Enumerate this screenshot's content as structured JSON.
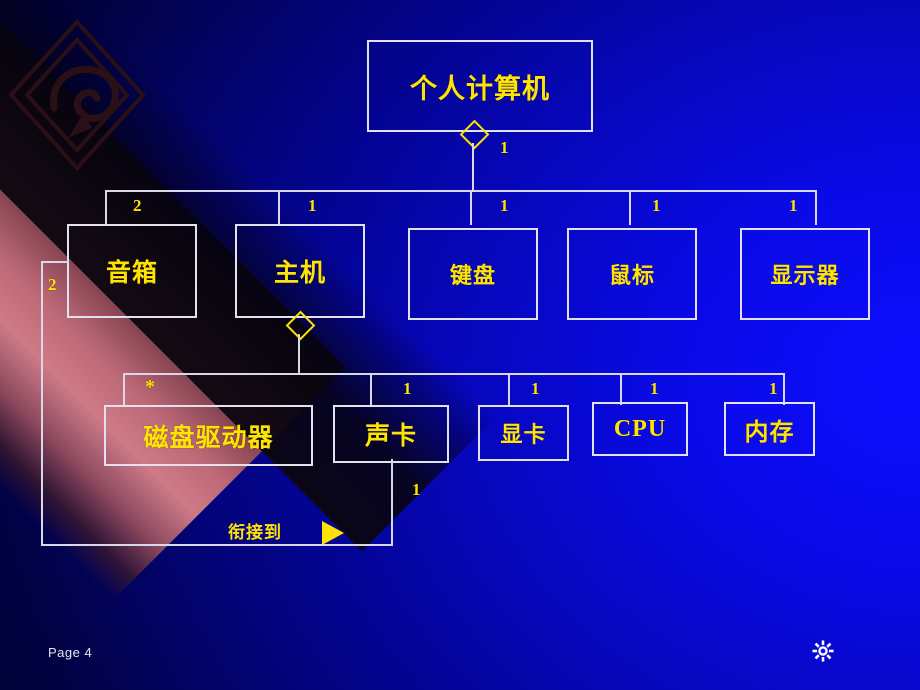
{
  "slide": {
    "page_label": "Page  4",
    "gear_icon": "gear-icon",
    "logo_icon": "diamond-swirl-logo"
  },
  "diagram": {
    "type": "uml-aggregation-hierarchy",
    "root": {
      "label": "个人计算机",
      "multiplicity": "1"
    },
    "level2": [
      {
        "label": "音箱",
        "multiplicity": "2"
      },
      {
        "label": "主机",
        "multiplicity": "1"
      },
      {
        "label": "键盘",
        "multiplicity": "1"
      },
      {
        "label": "鼠标",
        "multiplicity": "1"
      },
      {
        "label": "显示器",
        "multiplicity": "1"
      }
    ],
    "level3": [
      {
        "label": "磁盘驱动器",
        "multiplicity": "*"
      },
      {
        "label": "声卡",
        "multiplicity": "1"
      },
      {
        "label": "显卡",
        "multiplicity": "1"
      },
      {
        "label": "CPU",
        "multiplicity": "1"
      },
      {
        "label": "内存",
        "multiplicity": "1"
      }
    ],
    "association": {
      "label": "衔接到",
      "arrow": "right-triangle-arrowhead",
      "source_multiplicity": "1",
      "target_multiplicity": "2"
    }
  },
  "colors": {
    "accent_text": "#ffe400",
    "line": "#d8d8e8",
    "background_near": "#0d0dff",
    "background_far": "#00002b",
    "band": "#ce7a87"
  }
}
